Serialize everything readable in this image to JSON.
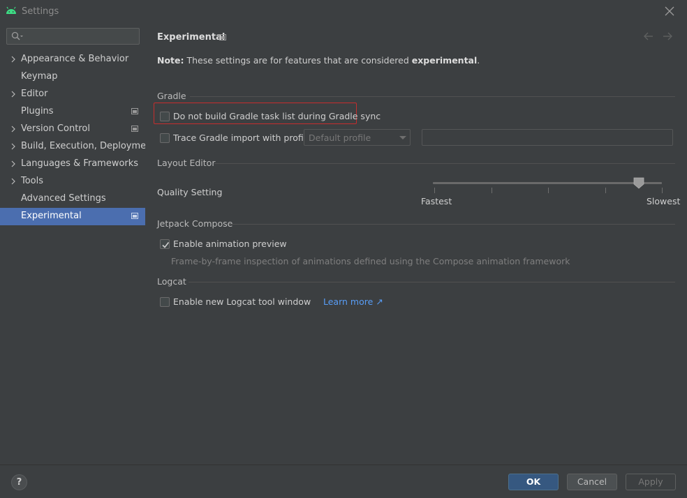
{
  "window": {
    "title": "Settings"
  },
  "sidebar": {
    "search": {
      "placeholder": ""
    },
    "items": [
      {
        "label": "Appearance & Behavior",
        "expandable": true,
        "project_level": false
      },
      {
        "label": "Keymap",
        "expandable": false,
        "project_level": false
      },
      {
        "label": "Editor",
        "expandable": true,
        "project_level": false
      },
      {
        "label": "Plugins",
        "expandable": false,
        "project_level": true
      },
      {
        "label": "Version Control",
        "expandable": true,
        "project_level": true
      },
      {
        "label": "Build, Execution, Deployment",
        "expandable": true,
        "project_level": false
      },
      {
        "label": "Languages & Frameworks",
        "expandable": true,
        "project_level": false
      },
      {
        "label": "Tools",
        "expandable": true,
        "project_level": false
      },
      {
        "label": "Advanced Settings",
        "expandable": false,
        "project_level": false
      },
      {
        "label": "Experimental",
        "expandable": false,
        "project_level": true,
        "selected": true
      }
    ]
  },
  "main": {
    "heading": "Experimental",
    "note": {
      "prefix": "Note:",
      "text": " These settings are for features that are considered ",
      "emphasis": "experimental",
      "suffix": "."
    },
    "sections": {
      "gradle": {
        "title": "Gradle",
        "skip_task_list": {
          "label": "Do not build Gradle task list during Gradle sync",
          "checked": false
        },
        "trace_import": {
          "label": "Trace Gradle import with profile:",
          "checked": false
        },
        "profile_combo": {
          "value": "Default profile"
        },
        "profile_path": {
          "value": ""
        }
      },
      "layout_editor": {
        "title": "Layout Editor",
        "quality_label": "Quality Setting",
        "slider": {
          "min_label": "Fastest",
          "max_label": "Slowest",
          "value_fraction": 0.9,
          "ticks": 5
        }
      },
      "jetpack_compose": {
        "title": "Jetpack Compose",
        "animation_preview": {
          "label": "Enable animation preview",
          "checked": true
        },
        "hint": "Frame-by-frame inspection of animations defined using the Compose animation framework"
      },
      "logcat": {
        "title": "Logcat",
        "new_logcat": {
          "label": "Enable new Logcat tool window",
          "checked": false
        },
        "learn_more": "Learn more ↗"
      }
    }
  },
  "footer": {
    "help": "?",
    "ok": "OK",
    "cancel": "Cancel",
    "apply": "Apply"
  },
  "colors": {
    "accent": "#4b6eaf",
    "ok_button": "#365880",
    "link": "#589df6",
    "highlight_box": "#c62d2d",
    "android_green": "#3ddc84"
  }
}
